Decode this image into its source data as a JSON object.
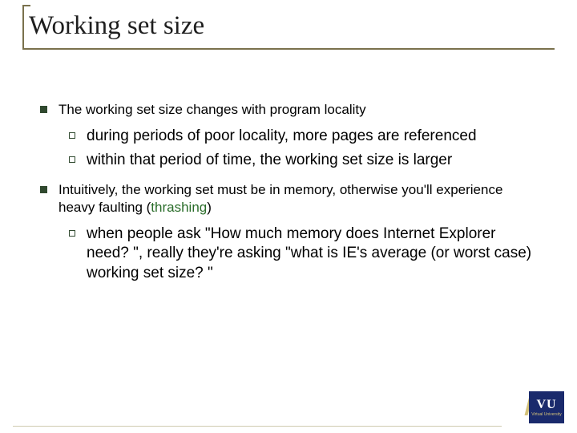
{
  "slide": {
    "title": "Working set size",
    "bullets": [
      {
        "text": "The working set size changes with program locality",
        "sub": [
          "during periods of poor locality, more pages are referenced",
          "within that period of time, the working set size is larger"
        ]
      },
      {
        "text_pre": "Intuitively, the working set must be in memory, otherwise you'll experience heavy faulting (",
        "thrash": "thrashing",
        "text_post": ")",
        "sub": [
          "when people ask \"How much memory does Internet Explorer need? \", really they're asking \"what is IE's average (or worst case) working set size? \""
        ]
      }
    ]
  },
  "logo": {
    "text": "VU",
    "subtext": "Virtual University"
  }
}
